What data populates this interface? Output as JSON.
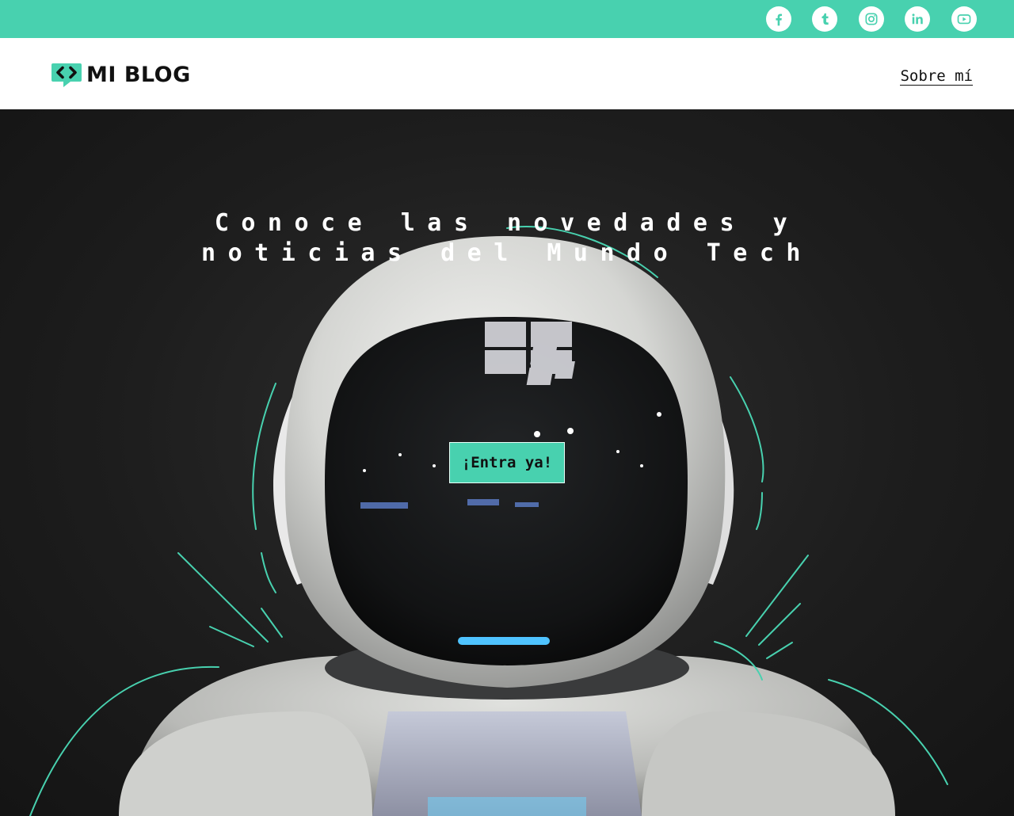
{
  "topbar": {
    "background_color": "#48d1af",
    "social_icons": [
      {
        "name": "facebook-icon"
      },
      {
        "name": "tumblr-icon"
      },
      {
        "name": "instagram-icon"
      },
      {
        "name": "linkedin-icon"
      },
      {
        "name": "youtube-icon"
      }
    ]
  },
  "header": {
    "logo_text": "MI BLOG",
    "logo_icon": "code-bubble-icon",
    "nav_link": "Sobre mí"
  },
  "hero": {
    "headline": "Conoce las novedades y noticias del Mundo Tech",
    "cta_label": "¡Entra ya!",
    "accent_color": "#48d1af",
    "image": "robot-astronaut-helmet"
  }
}
